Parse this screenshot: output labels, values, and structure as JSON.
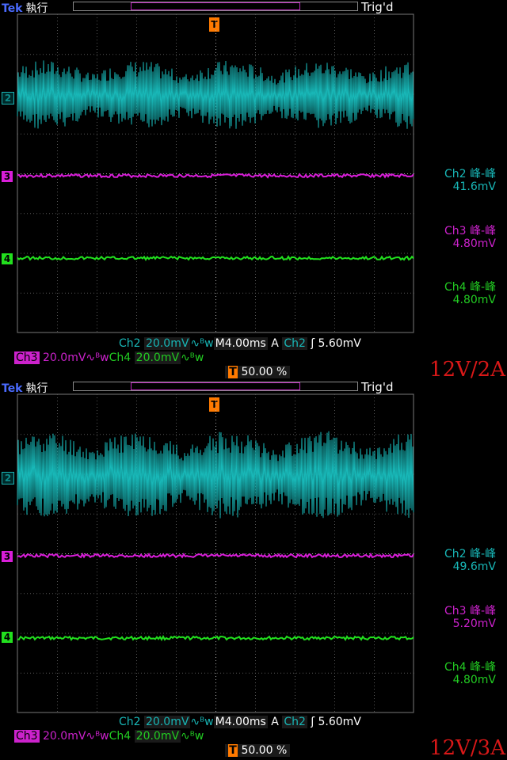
{
  "scopes": [
    {
      "brand": "Tek",
      "run_state": "執行",
      "trig_status": "Trig'd",
      "trigger_marker": "T",
      "channel_markers": {
        "ch2": "2",
        "ch3": "3",
        "ch4": "4"
      },
      "measurements": [
        {
          "label": "Ch2 峰-峰",
          "value": "41.6mV"
        },
        {
          "label": "Ch3 峰-峰",
          "value": "4.80mV"
        },
        {
          "label": "Ch4 峰-峰",
          "value": "4.80mV"
        }
      ],
      "status": {
        "ch2": "Ch2",
        "ch2_scale": "20.0mV",
        "timebase": "M4.00ms",
        "trig_mode": "A",
        "trig_source": "Ch2",
        "trig_level": "5.60mV",
        "ch3": "Ch3",
        "ch3_scale": "20.0mV",
        "ch4": "Ch4",
        "ch4_scale": "20.0mV",
        "trig_position": "50.00 %"
      },
      "caption": "12V/2A"
    },
    {
      "brand": "Tek",
      "run_state": "執行",
      "trig_status": "Trig'd",
      "trigger_marker": "T",
      "channel_markers": {
        "ch2": "2",
        "ch3": "3",
        "ch4": "4"
      },
      "measurements": [
        {
          "label": "Ch2 峰-峰",
          "value": "49.6mV"
        },
        {
          "label": "Ch3 峰-峰",
          "value": "5.20mV"
        },
        {
          "label": "Ch4 峰-峰",
          "value": "4.80mV"
        }
      ],
      "status": {
        "ch2": "Ch2",
        "ch2_scale": "20.0mV",
        "timebase": "M4.00ms",
        "trig_mode": "A",
        "trig_source": "Ch2",
        "trig_level": "5.60mV",
        "ch3": "Ch3",
        "ch3_scale": "20.0mV",
        "ch4": "Ch4",
        "ch4_scale": "20.0mV",
        "trig_position": "50.00 %"
      },
      "caption": "12V/3A"
    }
  ],
  "colors": {
    "ch2": "#18b7b7",
    "ch3": "#d91ed9",
    "ch4": "#22e01e",
    "trigger": "#ff7a00",
    "caption": "#d81818"
  }
}
